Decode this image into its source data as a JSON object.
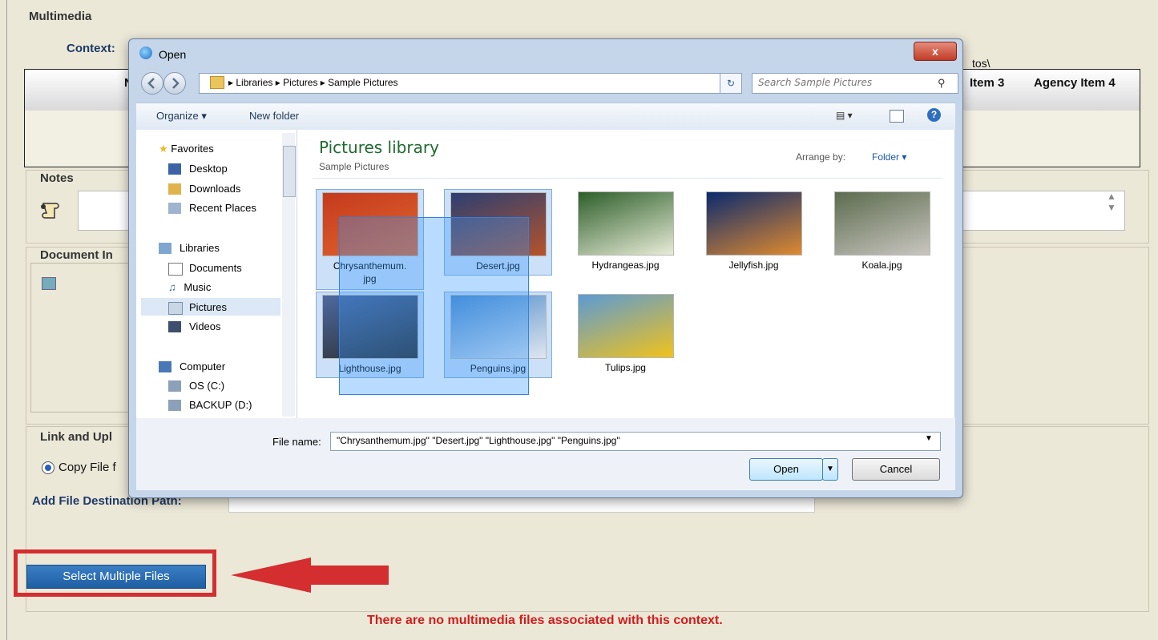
{
  "app": {
    "section_multimedia": "Multimedia",
    "context_label": "Context:",
    "context_path_tail": "tos\\",
    "grid_headers": [
      "N",
      "Item 3",
      "Agency Item 4"
    ],
    "notes_title": "Notes",
    "document_title": "Document In",
    "link_title": "Link and Upl",
    "copy_file_label": "Copy File f",
    "dest_path_label": "Add File Destination Path:",
    "select_multiple_label": "Select Multiple Files",
    "no_files_message": "There are no multimedia files associated with this context.",
    "highlight_color": "#d42e30"
  },
  "dialog": {
    "title": "Open",
    "close_glyph": "x",
    "breadcrumb": [
      "Libraries",
      "Pictures",
      "Sample Pictures"
    ],
    "search_placeholder": "Search Sample Pictures",
    "toolbar": {
      "organize": "Organize ▾",
      "new_folder": "New folder"
    },
    "nav_items": [
      {
        "label": "Favorites",
        "icon": "star-icon"
      },
      {
        "label": "Desktop",
        "icon": "desktop-icon"
      },
      {
        "label": "Downloads",
        "icon": "downloads-icon"
      },
      {
        "label": "Recent Places",
        "icon": "recent-icon"
      },
      {
        "label": "Libraries",
        "icon": "library-icon"
      },
      {
        "label": "Documents",
        "icon": "document-icon"
      },
      {
        "label": "Music",
        "icon": "music-icon"
      },
      {
        "label": "Pictures",
        "icon": "pictures-icon"
      },
      {
        "label": "Videos",
        "icon": "videos-icon"
      },
      {
        "label": "Computer",
        "icon": "computer-icon"
      },
      {
        "label": "OS (C:)",
        "icon": "drive-icon"
      },
      {
        "label": "BACKUP (D:)",
        "icon": "drive-icon"
      }
    ],
    "library_title": "Pictures library",
    "library_subtitle": "Sample Pictures",
    "arrange_label": "Arrange by:",
    "arrange_value": "Folder ▾",
    "files": [
      {
        "name": "Chrysanthemum.",
        "name2": "jpg",
        "selected": true,
        "colors": [
          "#c43a1d",
          "#e2672f"
        ]
      },
      {
        "name": "Desert.jpg",
        "name2": "",
        "selected": true,
        "colors": [
          "#2b3f73",
          "#b5532a"
        ]
      },
      {
        "name": "Hydrangeas.jpg",
        "name2": "",
        "selected": false,
        "colors": [
          "#2d5e2a",
          "#e8ecd7"
        ]
      },
      {
        "name": "Jellyfish.jpg",
        "name2": "",
        "selected": false,
        "colors": [
          "#0a2a6e",
          "#e08a2f"
        ]
      },
      {
        "name": "Koala.jpg",
        "name2": "",
        "selected": false,
        "colors": [
          "#5c6b4e",
          "#c9c6c0"
        ]
      },
      {
        "name": "Lighthouse.jpg",
        "name2": "",
        "selected": true,
        "colors": [
          "#4d6aa0",
          "#2b2b2b"
        ]
      },
      {
        "name": "Penguins.jpg",
        "name2": "",
        "selected": true,
        "colors": [
          "#4b8ac9",
          "#dfe6ee"
        ]
      },
      {
        "name": "Tulips.jpg",
        "name2": "",
        "selected": false,
        "colors": [
          "#5b9bd5",
          "#f1c21b"
        ]
      }
    ],
    "file_name_label": "File name:",
    "file_name_value": "\"Chrysanthemum.jpg\" \"Desert.jpg\" \"Lighthouse.jpg\" \"Penguins.jpg\"",
    "open_label": "Open",
    "cancel_label": "Cancel"
  }
}
